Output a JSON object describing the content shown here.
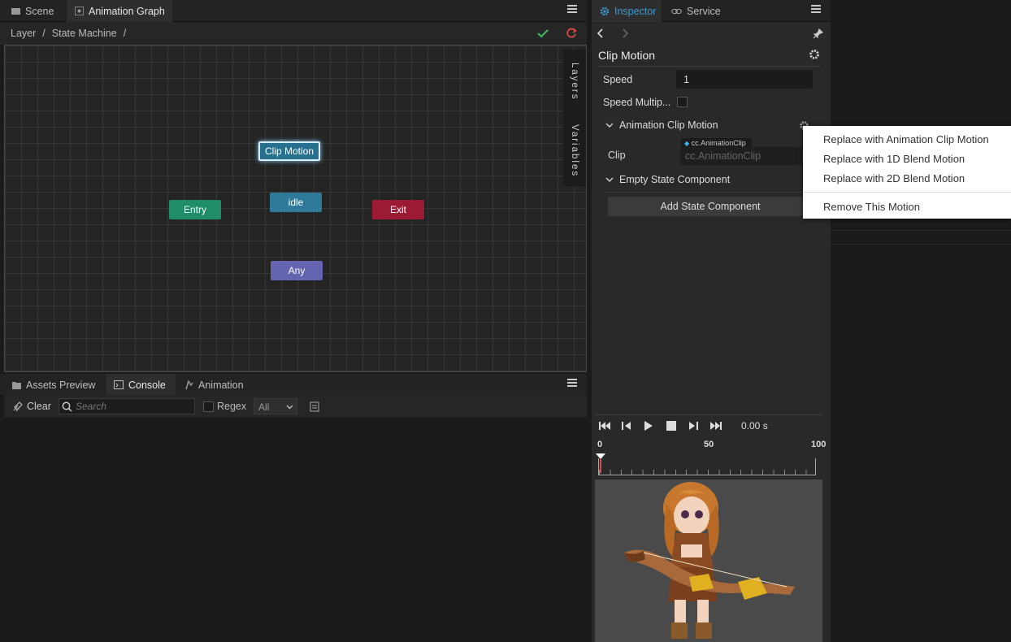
{
  "left_panel": {
    "tabs": [
      {
        "label": "Scene",
        "icon": "scene-icon"
      },
      {
        "label": "Animation Graph",
        "icon": "graph-icon"
      }
    ],
    "breadcrumb": {
      "layer": "Layer",
      "sep1": "/",
      "state_machine": "State Machine",
      "sep2": "/"
    },
    "graph": {
      "nodes": {
        "clip_motion": "Clip Motion",
        "entry": "Entry",
        "idle": "idle",
        "exit": "Exit",
        "any": "Any"
      },
      "side_tabs": {
        "layers": "Layers",
        "variables": "Variables"
      }
    }
  },
  "bottom_panel": {
    "tabs": [
      {
        "label": "Assets Preview",
        "icon": "folder-icon"
      },
      {
        "label": "Console",
        "icon": "terminal-icon"
      },
      {
        "label": "Animation",
        "icon": "animation-icon"
      }
    ],
    "clear_label": "Clear",
    "search_placeholder": "Search",
    "regex_label": "Regex",
    "level_select": "All"
  },
  "inspector": {
    "tabs": [
      {
        "label": "Inspector",
        "icon": "gear-icon"
      },
      {
        "label": "Service",
        "icon": "link-icon"
      }
    ],
    "title": "Clip Motion",
    "speed_label": "Speed",
    "speed_value": "1",
    "speed_mult_label": "Speed Multip...",
    "section_clip_motion": "Animation Clip Motion",
    "clip_label": "Clip",
    "clip_type_tag": "cc.AnimationClip",
    "clip_placeholder": "cc.AnimationClip",
    "section_empty_state": "Empty State Component",
    "add_state_button": "Add State Component",
    "timeline": {
      "time": "0.00 s",
      "ticks": [
        "0",
        "50",
        "100"
      ]
    }
  },
  "context_menu": {
    "items": [
      "Replace with Animation Clip Motion",
      "Replace with 1D Blend Motion",
      "Replace with 2D Blend Motion"
    ],
    "remove": "Remove This Motion"
  },
  "colors": {
    "accent": "#3d9bd4",
    "entry": "#1f8c6a",
    "idle": "#2f7a99",
    "exit": "#9c1b34",
    "any": "#6464b0",
    "clip_motion": "#28718e"
  }
}
